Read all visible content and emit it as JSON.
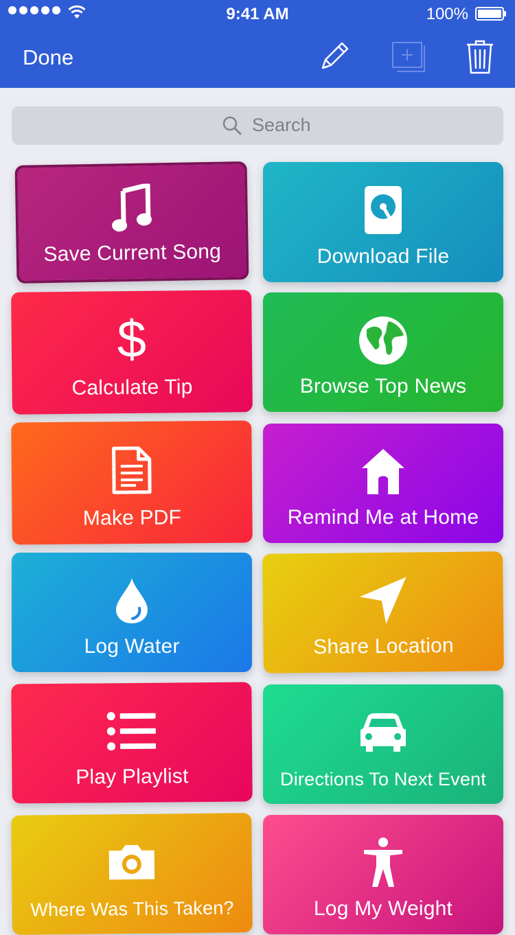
{
  "status_bar": {
    "time": "9:41 AM",
    "battery": "100%"
  },
  "nav": {
    "done_label": "Done"
  },
  "search": {
    "placeholder": "Search"
  },
  "workflows": [
    {
      "label": "Save Current Song",
      "icon": "music-note-icon",
      "colors": [
        "#b7267d",
        "#9c1476"
      ]
    },
    {
      "label": "Download File",
      "icon": "hard-drive-icon",
      "colors": [
        "#1fb6c6",
        "#158ebe"
      ]
    },
    {
      "label": "Calculate Tip",
      "icon": "dollar-sign-icon",
      "colors": [
        "#ff2a48",
        "#e8085a"
      ]
    },
    {
      "label": "Browse Top News",
      "icon": "globe-icon",
      "colors": [
        "#1fbb55",
        "#26b52e"
      ]
    },
    {
      "label": "Make PDF",
      "icon": "document-icon",
      "colors": [
        "#ff6a1c",
        "#f8243c"
      ]
    },
    {
      "label": "Remind Me at Home",
      "icon": "home-icon",
      "colors": [
        "#c61fcf",
        "#8a06e8"
      ]
    },
    {
      "label": "Log Water",
      "icon": "water-drop-icon",
      "colors": [
        "#1cb0d6",
        "#1b78e8"
      ]
    },
    {
      "label": "Share Location",
      "icon": "location-arrow-icon",
      "colors": [
        "#e7d011",
        "#ee8c0f"
      ]
    },
    {
      "label": "Play Playlist",
      "icon": "list-icon",
      "colors": [
        "#ff2a4e",
        "#e8065e"
      ]
    },
    {
      "label": "Directions To Next Event",
      "icon": "car-icon",
      "colors": [
        "#1edc92",
        "#1ab27a"
      ]
    },
    {
      "label": "Where Was This Taken?",
      "icon": "camera-icon",
      "colors": [
        "#e8cc12",
        "#ee8a10"
      ]
    },
    {
      "label": "Log My Weight",
      "icon": "person-icon",
      "colors": [
        "#ff4d8d",
        "#c7147e"
      ]
    }
  ]
}
